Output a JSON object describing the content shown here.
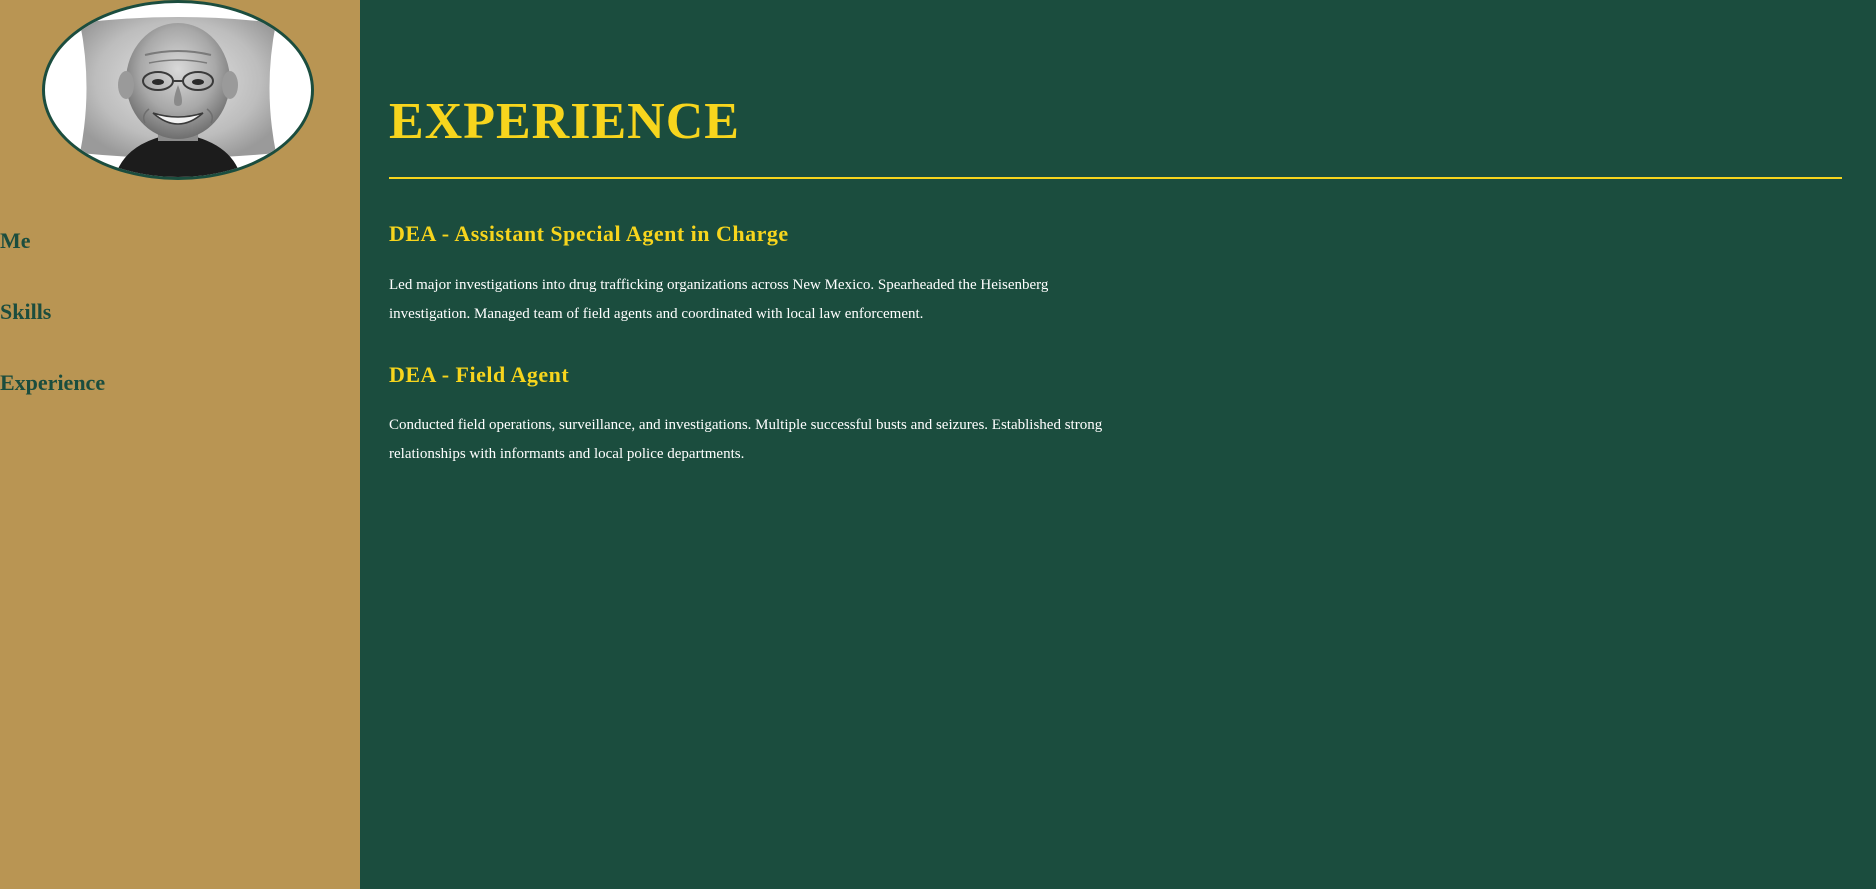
{
  "sidebar": {
    "avatar_alt": "profile photo",
    "nav": [
      {
        "label": "Me"
      },
      {
        "label": "Skills"
      },
      {
        "label": "Experience"
      }
    ]
  },
  "main": {
    "title": "EXPERIENCE",
    "jobs": [
      {
        "title": "DEA - Assistant Special Agent in Charge",
        "description": "Led major investigations into drug trafficking organizations across New Mexico. Spearheaded the Heisenberg investigation. Managed team of field agents and coordinated with local law enforcement."
      },
      {
        "title": "DEA - Field Agent",
        "description": "Conducted field operations, surveillance, and investigations. Multiple successful busts and seizures. Established strong relationships with informants and local police departments."
      }
    ]
  },
  "colors": {
    "sidebar_bg": "#b99553",
    "main_bg": "#1b4d3e",
    "accent": "#f7d51d",
    "nav_text": "#1b4d3e",
    "body_text": "#ffffff"
  }
}
